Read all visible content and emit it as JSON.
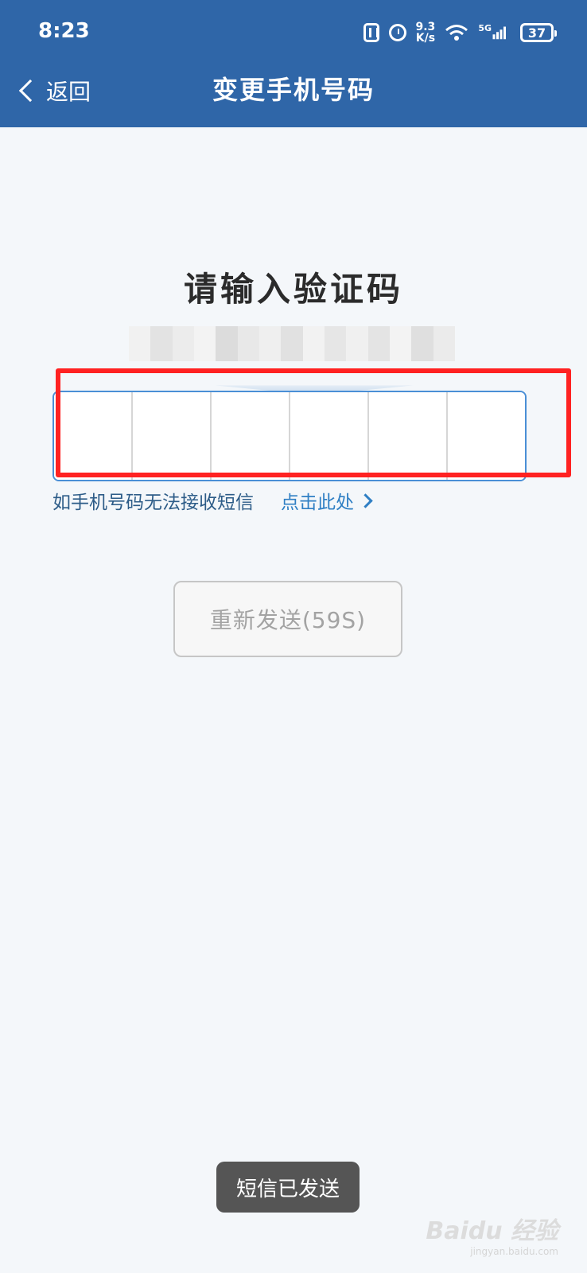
{
  "status_bar": {
    "time": "8:23",
    "net_speed_value": "9.3",
    "net_speed_unit": "K/s",
    "signal_label": "5G",
    "battery_level": "37",
    "icons": [
      "nfc-icon",
      "alarm-icon",
      "wifi-icon",
      "signal-icon",
      "battery-icon"
    ]
  },
  "nav": {
    "back_label": "返回",
    "title": "变更手机号码"
  },
  "main": {
    "prompt_title": "请输入验证码",
    "code_length": 6,
    "code_values": [
      "",
      "",
      "",
      "",
      "",
      ""
    ],
    "help_text": "如手机号码无法接收短信",
    "help_link": "点击此处",
    "resend_label": "重新发送(59S)"
  },
  "toast": {
    "message": "短信已发送"
  },
  "watermark": {
    "brand": "Baidu 经验",
    "url": "jingyan.baidu.com"
  },
  "colors": {
    "header": "#2f66a8",
    "background": "#f4f7fa",
    "accent_link": "#2f7fc4",
    "highlight": "#ff2222",
    "input_border": "#4a8fd6"
  }
}
